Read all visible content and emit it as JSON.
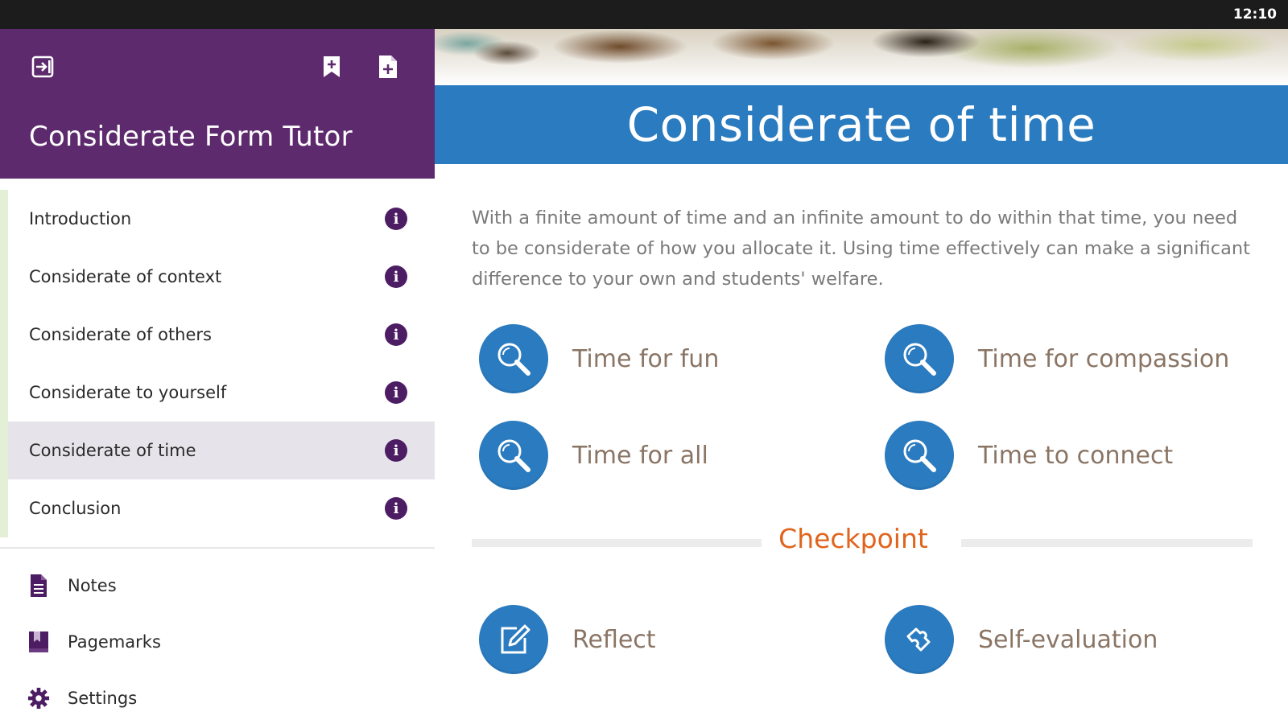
{
  "status_bar": {
    "time": "12:10"
  },
  "sidebar": {
    "app_title": "Considerate Form Tutor",
    "header_icons": [
      "exit-icon",
      "bookmark-add-icon",
      "note-add-icon"
    ],
    "toc": [
      {
        "label": "Introduction",
        "active": false
      },
      {
        "label": "Considerate of context",
        "active": false
      },
      {
        "label": "Considerate of others",
        "active": false
      },
      {
        "label": "Considerate to yourself",
        "active": false
      },
      {
        "label": "Considerate of time",
        "active": true
      },
      {
        "label": "Conclusion",
        "active": false
      }
    ],
    "info_glyph": "i",
    "menu": [
      {
        "label": "Notes",
        "icon": "notes-icon"
      },
      {
        "label": "Pagemarks",
        "icon": "pagemarks-icon"
      },
      {
        "label": "Settings",
        "icon": "gear-icon"
      }
    ],
    "colors": {
      "header": "#5e2a6e",
      "info_dot": "#4d1d64",
      "active_row": "#e6e4ea",
      "accent_strip": "#e4f0d6"
    }
  },
  "main": {
    "title": "Considerate of time",
    "intro": "With a finite amount of time and an infinite amount to do within that time, you need to be considerate of how you allocate it. Using time effectively can make a significant difference to your own and students' welfare.",
    "topics": [
      {
        "label": "Time for fun",
        "icon": "magnifier-icon"
      },
      {
        "label": "Time for compassion",
        "icon": "magnifier-icon"
      },
      {
        "label": "Time for all",
        "icon": "magnifier-icon"
      },
      {
        "label": "Time to connect",
        "icon": "magnifier-icon"
      }
    ],
    "checkpoint": {
      "title": "Checkpoint",
      "items": [
        {
          "label": "Reflect",
          "icon": "pencil-edit-icon"
        },
        {
          "label": "Self-evaluation",
          "icon": "puzzle-icon"
        }
      ]
    },
    "colors": {
      "title_bar": "#2a7bbf",
      "checkpoint": "#e0641c",
      "topic_text": "#8a7565"
    }
  }
}
